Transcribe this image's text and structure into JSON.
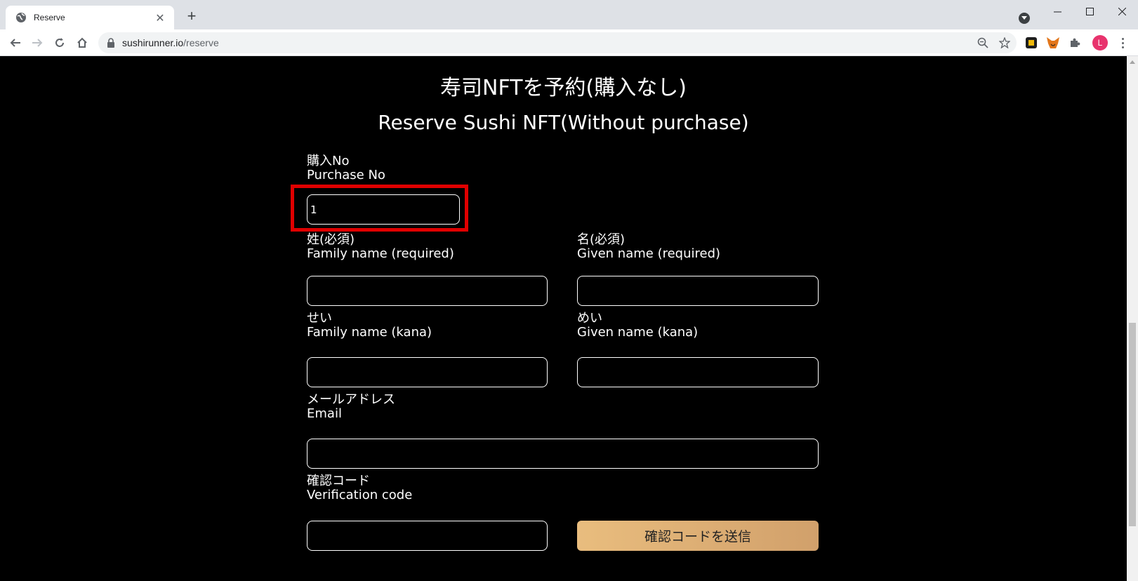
{
  "browser": {
    "tab_title": "Reserve",
    "new_tab_symbol": "+",
    "url_domain": "sushirunner.io",
    "url_path": "/reserve",
    "avatar_letter": "L"
  },
  "page": {
    "title_ja": "寿司NFTを予約(購入なし)",
    "title_en": "Reserve Sushi NFT(Without purchase)",
    "purchase_no": {
      "label_ja": "購入No",
      "label_en": "Purchase No",
      "value": "1"
    },
    "family_name": {
      "label_ja": "姓(必須)",
      "label_en": "Family name (required)",
      "value": ""
    },
    "given_name": {
      "label_ja": "名(必須)",
      "label_en": "Given name (required)",
      "value": ""
    },
    "family_kana": {
      "label_ja": "せい",
      "label_en": "Family name (kana)",
      "value": ""
    },
    "given_kana": {
      "label_ja": "めい",
      "label_en": "Given name (kana)",
      "value": ""
    },
    "email": {
      "label_ja": "メールアドレス",
      "label_en": "Email",
      "value": ""
    },
    "verification": {
      "label_ja": "確認コード",
      "label_en": "Verification code",
      "value": ""
    },
    "send_code_button": "確認コードを送信"
  },
  "colors": {
    "highlight": "#e00000",
    "button_gradient_start": "#e9bd7e",
    "button_gradient_end": "#d1a06b",
    "background": "#000000"
  }
}
